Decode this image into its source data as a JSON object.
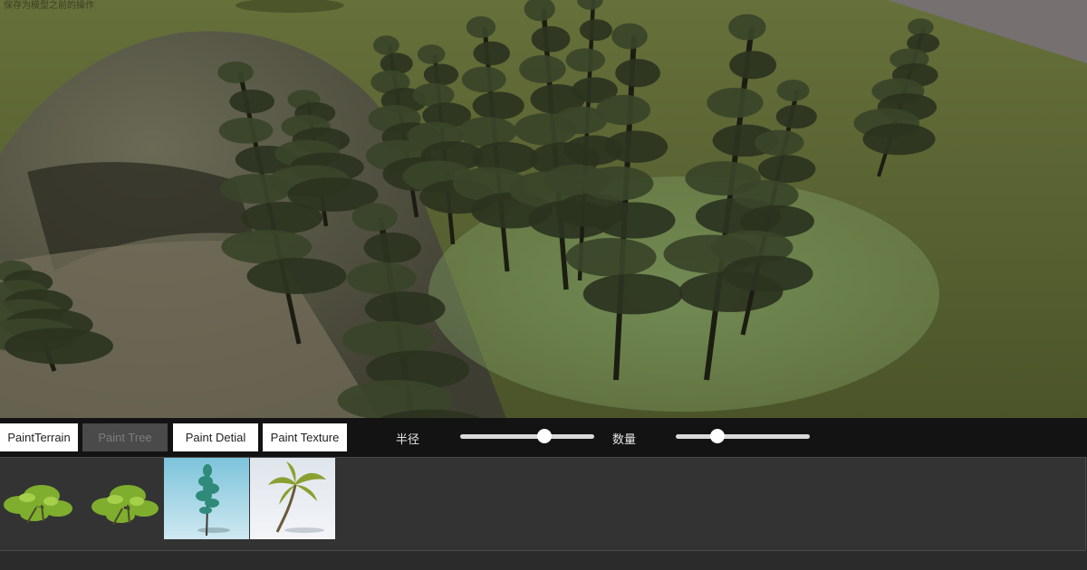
{
  "viewport": {
    "hint_text": "保存为模型之前的操作"
  },
  "toolbar": {
    "buttons": [
      {
        "label": "PaintTerrain",
        "state": "active"
      },
      {
        "label": "Paint Tree",
        "state": "disabled"
      },
      {
        "label": "Paint Detial",
        "state": "active"
      },
      {
        "label": "Paint Texture",
        "state": "active"
      }
    ],
    "radius": {
      "label": "半径",
      "value": 0.63
    },
    "count": {
      "label": "数量",
      "value": 0.31
    }
  },
  "palette": {
    "items": [
      {
        "icon": "bush-icon",
        "selected": false
      },
      {
        "icon": "bush-icon",
        "selected": false
      },
      {
        "icon": "conifer-tree-icon",
        "selected": true
      },
      {
        "icon": "palm-tree-icon",
        "selected": false
      }
    ]
  },
  "colors": {
    "terrain": "#5a6330",
    "hill": "#5a5845",
    "brush": "#6f8a55",
    "toolbar": "#131313",
    "panel": "#333333"
  }
}
